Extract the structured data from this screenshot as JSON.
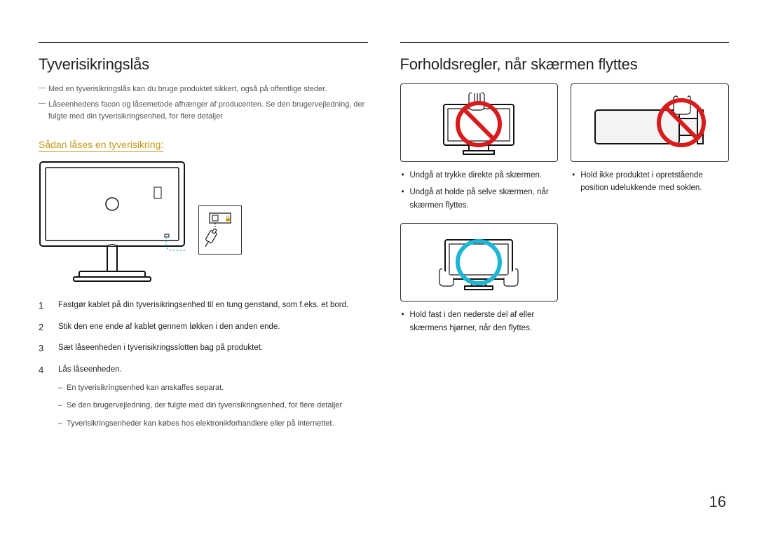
{
  "pageNumber": "16",
  "left": {
    "heading": "Tyverisikringslås",
    "intro": [
      "Med en tyverisikringslås kan du bruge produktet sikkert, også på offentlige steder.",
      "Låseenhedens facon og låsemetode afhænger af producenten. Se den brugervejledning, der fulgte med din tyverisikringsenhed, for flere detaljer"
    ],
    "subhead": "Sådan låses en tyverisikring:",
    "steps": [
      {
        "n": "1",
        "t": "Fastgør kablet på din tyverisikringsenhed til en tung genstand, som f.eks. et bord."
      },
      {
        "n": "2",
        "t": "Stik den ene ende af kablet gennem løkken i den anden ende."
      },
      {
        "n": "3",
        "t": "Sæt låseenheden i tyverisikringsslotten bag på produktet."
      },
      {
        "n": "4",
        "t": "Lås låseenheden."
      }
    ],
    "substeps": [
      "En tyverisikringsenhed kan anskaffes separat.",
      "Se den brugervejledning, der fulgte med din tyverisikringsenhed, for flere detaljer",
      "Tyverisikringsenheder kan købes hos elektronikforhandlere eller på internettet."
    ]
  },
  "right": {
    "heading": "Forholdsregler, når skærmen flyttes",
    "row1": {
      "leftBullets": [
        "Undgå at trykke direkte på skærmen.",
        "Undgå at holde på selve skærmen, når skærmen flyttes."
      ],
      "rightBullets": [
        "Hold ikke produktet i opretstående position udelukkende med soklen."
      ]
    },
    "row2": {
      "leftBullets": [
        "Hold fast i den nederste del af eller skærmens hjørner, når den flyttes."
      ]
    }
  }
}
